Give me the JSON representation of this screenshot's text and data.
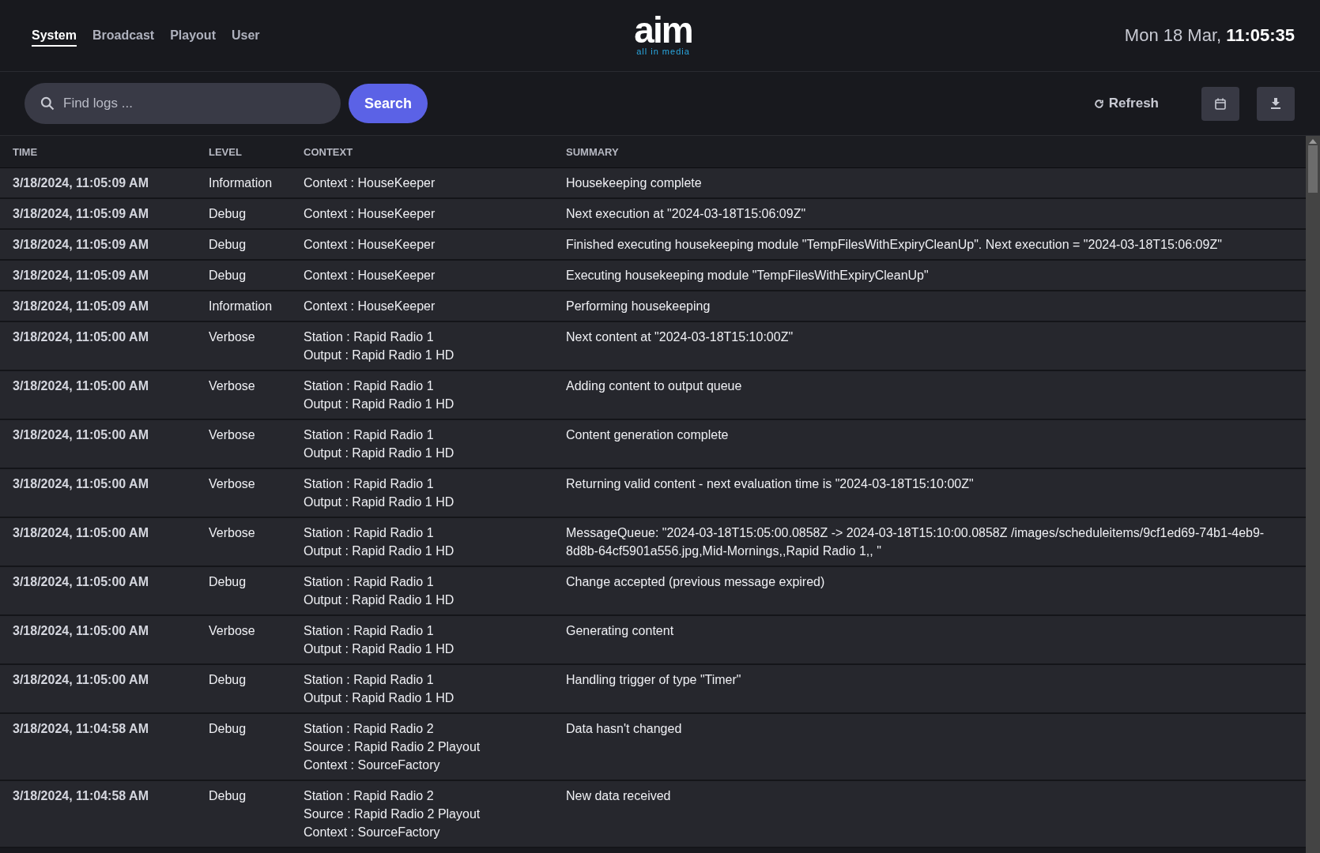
{
  "nav": {
    "tabs": [
      {
        "label": "System",
        "selected": true
      },
      {
        "label": "Broadcast",
        "selected": false
      },
      {
        "label": "Playout",
        "selected": false
      },
      {
        "label": "User",
        "selected": false
      }
    ]
  },
  "logo": {
    "wordmark": "aim",
    "tagline": "all in media"
  },
  "clock": {
    "date": "Mon 18 Mar,",
    "time": "11:05:35"
  },
  "toolbar": {
    "search": {
      "placeholder": "Find logs ..."
    },
    "search_button": "Search",
    "refresh_button": "Refresh"
  },
  "table": {
    "columns": [
      "TIME",
      "LEVEL",
      "CONTEXT",
      "SUMMARY"
    ],
    "rows": [
      {
        "time": "3/18/2024, 11:05:09 AM",
        "level": "Information",
        "context": [
          "Context : HouseKeeper"
        ],
        "summary": "Housekeeping complete"
      },
      {
        "time": "3/18/2024, 11:05:09 AM",
        "level": "Debug",
        "context": [
          "Context : HouseKeeper"
        ],
        "summary": "Next execution at \"2024-03-18T15:06:09Z\""
      },
      {
        "time": "3/18/2024, 11:05:09 AM",
        "level": "Debug",
        "context": [
          "Context : HouseKeeper"
        ],
        "summary": "Finished executing housekeeping module \"TempFilesWithExpiryCleanUp\".  Next execution = \"2024-03-18T15:06:09Z\""
      },
      {
        "time": "3/18/2024, 11:05:09 AM",
        "level": "Debug",
        "context": [
          "Context : HouseKeeper"
        ],
        "summary": "Executing housekeeping module \"TempFilesWithExpiryCleanUp\""
      },
      {
        "time": "3/18/2024, 11:05:09 AM",
        "level": "Information",
        "context": [
          "Context : HouseKeeper"
        ],
        "summary": "Performing housekeeping"
      },
      {
        "time": "3/18/2024, 11:05:00 AM",
        "level": "Verbose",
        "context": [
          "Station : Rapid Radio 1",
          "Output : Rapid Radio 1 HD"
        ],
        "summary": "Next content at \"2024-03-18T15:10:00Z\""
      },
      {
        "time": "3/18/2024, 11:05:00 AM",
        "level": "Verbose",
        "context": [
          "Station : Rapid Radio 1",
          "Output : Rapid Radio 1 HD"
        ],
        "summary": "Adding content to output queue"
      },
      {
        "time": "3/18/2024, 11:05:00 AM",
        "level": "Verbose",
        "context": [
          "Station : Rapid Radio 1",
          "Output : Rapid Radio 1 HD"
        ],
        "summary": "Content generation complete"
      },
      {
        "time": "3/18/2024, 11:05:00 AM",
        "level": "Verbose",
        "context": [
          "Station : Rapid Radio 1",
          "Output : Rapid Radio 1 HD"
        ],
        "summary": "Returning valid content - next evaluation time is \"2024-03-18T15:10:00Z\""
      },
      {
        "time": "3/18/2024, 11:05:00 AM",
        "level": "Verbose",
        "context": [
          "Station : Rapid Radio 1",
          "Output : Rapid Radio 1 HD"
        ],
        "summary": "MessageQueue: \"2024-03-18T15:05:00.0858Z -> 2024-03-18T15:10:00.0858Z /images/scheduleitems/9cf1ed69-74b1-4eb9-8d8b-64cf5901a556.jpg,Mid-Mornings,,Rapid Radio 1,, \""
      },
      {
        "time": "3/18/2024, 11:05:00 AM",
        "level": "Debug",
        "context": [
          "Station : Rapid Radio 1",
          "Output : Rapid Radio 1 HD"
        ],
        "summary": "Change accepted (previous message expired)"
      },
      {
        "time": "3/18/2024, 11:05:00 AM",
        "level": "Verbose",
        "context": [
          "Station : Rapid Radio 1",
          "Output : Rapid Radio 1 HD"
        ],
        "summary": "Generating content"
      },
      {
        "time": "3/18/2024, 11:05:00 AM",
        "level": "Debug",
        "context": [
          "Station : Rapid Radio 1",
          "Output : Rapid Radio 1 HD"
        ],
        "summary": "Handling trigger of type \"Timer\""
      },
      {
        "time": "3/18/2024, 11:04:58 AM",
        "level": "Debug",
        "context": [
          "Station : Rapid Radio 2",
          "Source : Rapid Radio 2 Playout",
          "Context : SourceFactory"
        ],
        "summary": "Data hasn't changed"
      },
      {
        "time": "3/18/2024, 11:04:58 AM",
        "level": "Debug",
        "context": [
          "Station : Rapid Radio 2",
          "Source : Rapid Radio 2 Playout",
          "Context : SourceFactory"
        ],
        "summary": "New data received"
      }
    ]
  }
}
